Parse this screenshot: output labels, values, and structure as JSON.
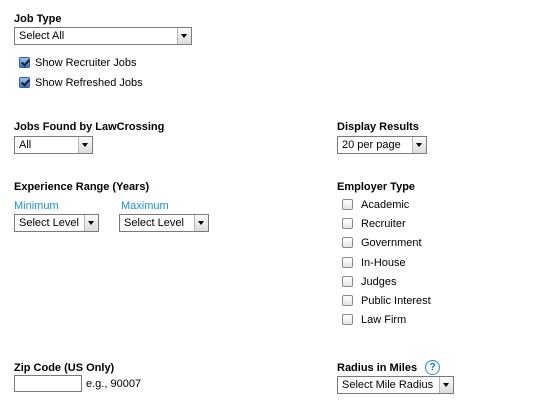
{
  "job_type": {
    "heading": "Job Type",
    "select_value": "Select All",
    "show_recruiter_label": "Show Recruiter Jobs",
    "show_recruiter_checked": true,
    "show_refreshed_label": "Show Refreshed Jobs",
    "show_refreshed_checked": true
  },
  "jobs_found": {
    "heading": "Jobs Found by LawCrossing",
    "select_value": "All"
  },
  "display_results": {
    "heading": "Display Results",
    "select_value": "20 per page"
  },
  "experience_range": {
    "heading": "Experience Range (Years)",
    "minimum_label": "Minimum",
    "maximum_label": "Maximum",
    "minimum_value": "Select Level",
    "maximum_value": "Select Level"
  },
  "employer_type": {
    "heading": "Employer Type",
    "options": [
      {
        "label": "Academic",
        "checked": false
      },
      {
        "label": "Recruiter",
        "checked": false
      },
      {
        "label": "Government",
        "checked": false
      },
      {
        "label": "In-House",
        "checked": false
      },
      {
        "label": "Judges",
        "checked": false
      },
      {
        "label": "Public Interest",
        "checked": false
      },
      {
        "label": "Law Firm",
        "checked": false
      }
    ]
  },
  "zip_code": {
    "heading": "Zip Code (US Only)",
    "value": "",
    "example": "e.g., 90007"
  },
  "radius": {
    "heading": "Radius in Miles",
    "help_symbol": "?",
    "select_value": "Select Mile Radius"
  },
  "colors": {
    "sublabel": "#1a8fd6",
    "checkbox_checked": "#3a78c2"
  }
}
